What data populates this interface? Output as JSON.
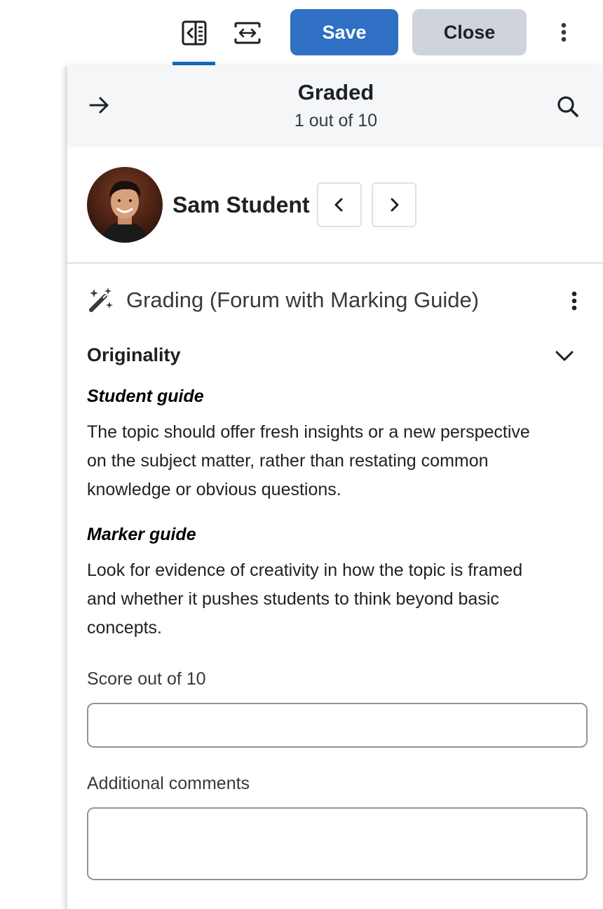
{
  "toolbar": {
    "collapse_icon": "collapse-panel-icon",
    "expand_icon": "expand-width-icon",
    "save_label": "Save",
    "close_label": "Close",
    "more_icon": "vertical-dots-icon",
    "accent_color": "#0f6cbf"
  },
  "drawer": {
    "header": {
      "title": "Graded",
      "subtitle": "1 out of 10",
      "back_icon": "arrow-right-icon",
      "search_icon": "search-icon"
    },
    "student": {
      "name": "Sam Student",
      "prev_icon": "chevron-left-icon",
      "next_icon": "chevron-right-icon"
    },
    "grading": {
      "title": "Grading (Forum with Marking Guide)",
      "icon": "magic-wand-icon",
      "criterion": {
        "name": "Originality",
        "student_guide_label": "Student guide",
        "student_guide_lines": [
          "The topic should offer fresh insights or a new perspective",
          "on the subject matter, rather than restating common",
          "knowledge or obvious questions."
        ],
        "marker_guide_label": "Marker guide",
        "marker_guide_lines": [
          "Look for evidence of creativity in how the topic is framed",
          "and whether it pushes students to think beyond basic",
          "concepts."
        ],
        "score_label": "Score out of 10",
        "score_value": "",
        "comments_label": "Additional comments",
        "comments_value": ""
      }
    }
  }
}
